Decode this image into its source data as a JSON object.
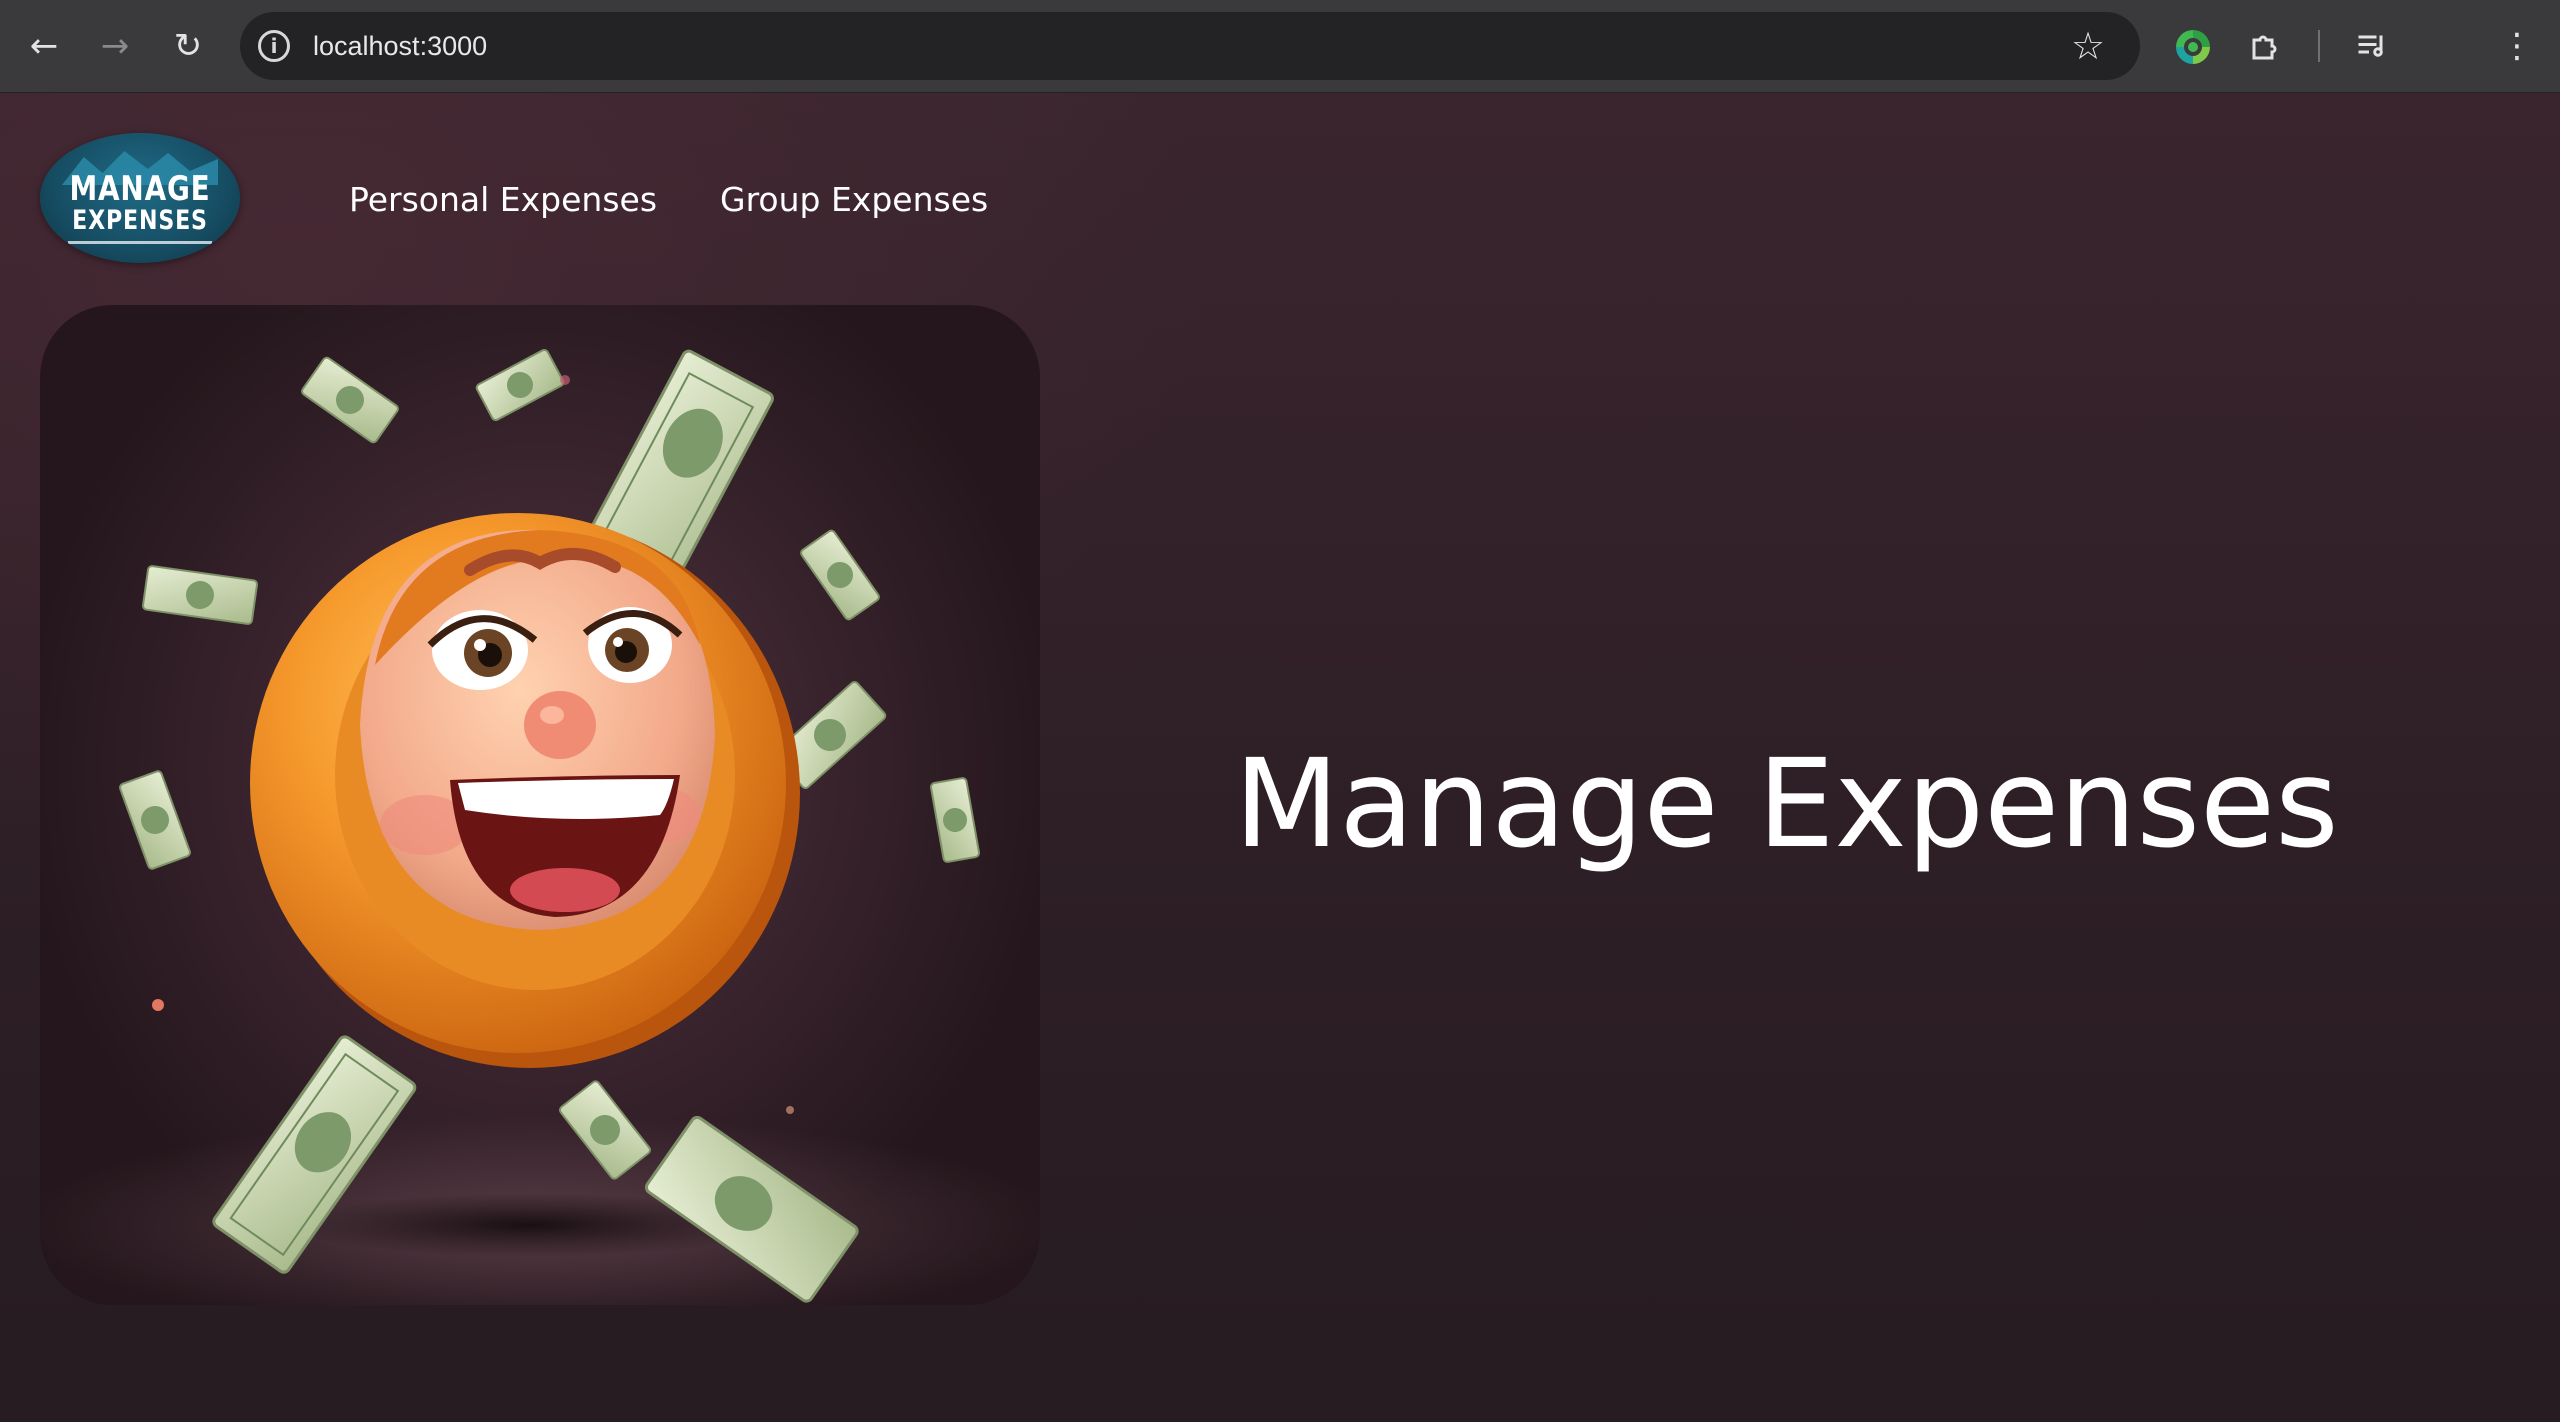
{
  "browser": {
    "url": "localhost:3000",
    "icons": {
      "back": "arrow-left-icon",
      "forward": "arrow-right-icon",
      "reload": "reload-icon",
      "site_info": "info-icon",
      "bookmark": "star-icon",
      "extension": "extension-ring-icon",
      "extensions_menu": "puzzle-icon",
      "media": "media-queue-icon",
      "menu": "kebab-menu-icon"
    }
  },
  "header": {
    "logo_line1": "MANAGE",
    "logo_line2": "EXPENSES",
    "nav": [
      {
        "label": "Personal Expenses"
      },
      {
        "label": "Group Expenses"
      }
    ]
  },
  "hero": {
    "headline": "Manage Expenses",
    "image_subject": "smiling orange coin character with flying dollar bills"
  },
  "colors": {
    "page_bg": "#2e1f26",
    "chrome_bg": "#3a3a3c",
    "omnibox_bg": "#232325",
    "text": "#ffffff",
    "coin_orange": "#f39a2b",
    "bill_green": "#c9d6b0",
    "logo_blue": "#1f6b86"
  }
}
